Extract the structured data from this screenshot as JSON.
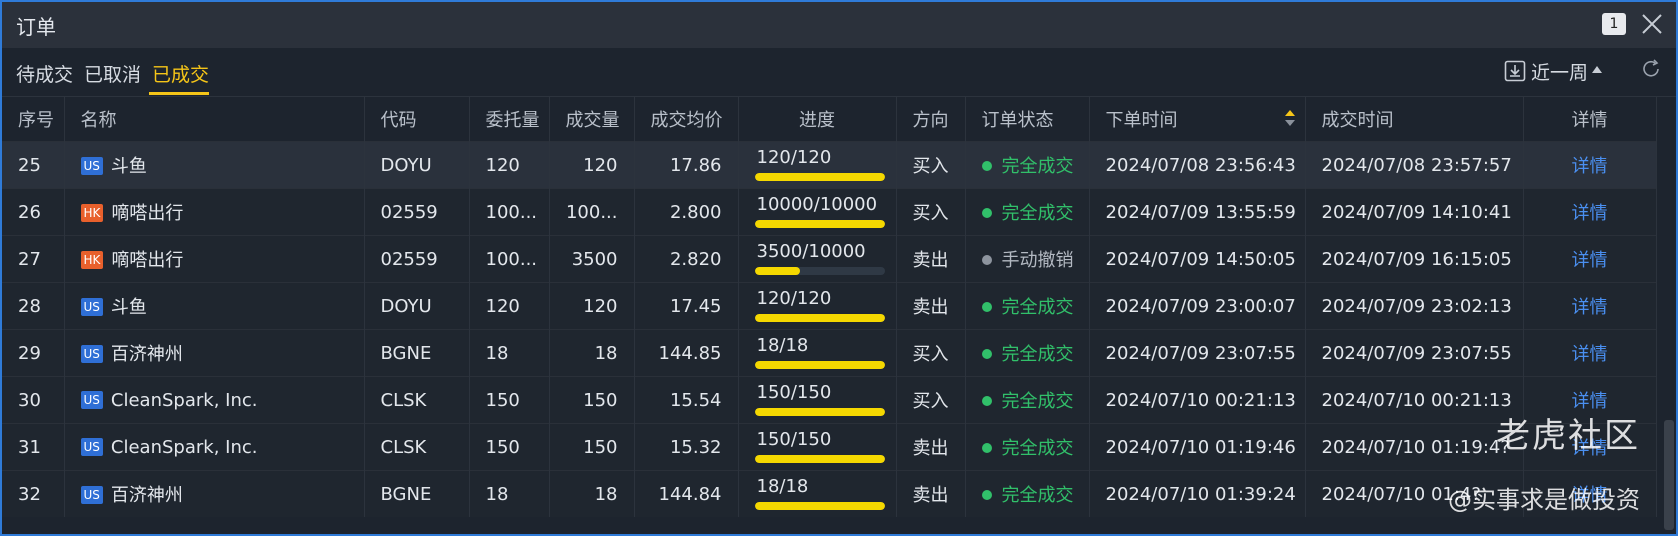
{
  "window": {
    "title": "订单",
    "badge": "1"
  },
  "tabs": [
    {
      "label": "待成交"
    },
    {
      "label": "已取消"
    },
    {
      "label": "已成交"
    }
  ],
  "filter": {
    "period": "近一周"
  },
  "columns": {
    "seq": "序号",
    "name": "名称",
    "code": "代码",
    "order_qty": "委托量",
    "filled_qty": "成交量",
    "avg_price": "成交均价",
    "progress": "进度",
    "direction": "方向",
    "status": "订单状态",
    "order_time": "下单时间",
    "fill_time": "成交时间",
    "detail": "详情"
  },
  "rows": [
    {
      "seq": "25",
      "market": "US",
      "name": "斗鱼",
      "code": "DOYU",
      "order_qty": "120",
      "filled_qty": "120",
      "avg_price": "17.86",
      "progress_text": "120/120",
      "progress": 1.0,
      "direction": "买入",
      "dir_type": "buy",
      "status": "完全成交",
      "status_type": "filled",
      "order_time": "2024/07/08 23:56:43",
      "fill_time": "2024/07/08 23:57:57",
      "detail": "详情"
    },
    {
      "seq": "26",
      "market": "HK",
      "name": "嘀嗒出行",
      "code": "02559",
      "order_qty": "100...",
      "filled_qty": "100...",
      "avg_price": "2.800",
      "progress_text": "10000/10000",
      "progress": 1.0,
      "direction": "买入",
      "dir_type": "buy",
      "status": "完全成交",
      "status_type": "filled",
      "order_time": "2024/07/09 13:55:59",
      "fill_time": "2024/07/09 14:10:41",
      "detail": "详情"
    },
    {
      "seq": "27",
      "market": "HK",
      "name": "嘀嗒出行",
      "code": "02559",
      "order_qty": "100...",
      "filled_qty": "3500",
      "avg_price": "2.820",
      "progress_text": "3500/10000",
      "progress": 0.35,
      "direction": "卖出",
      "dir_type": "sell",
      "status": "手动撤销",
      "status_type": "cancelled",
      "order_time": "2024/07/09 14:50:05",
      "fill_time": "2024/07/09 16:15:05",
      "detail": "详情"
    },
    {
      "seq": "28",
      "market": "US",
      "name": "斗鱼",
      "code": "DOYU",
      "order_qty": "120",
      "filled_qty": "120",
      "avg_price": "17.45",
      "progress_text": "120/120",
      "progress": 1.0,
      "direction": "卖出",
      "dir_type": "sell",
      "status": "完全成交",
      "status_type": "filled",
      "order_time": "2024/07/09 23:00:07",
      "fill_time": "2024/07/09 23:02:13",
      "detail": "详情"
    },
    {
      "seq": "29",
      "market": "US",
      "name": "百济神州",
      "code": "BGNE",
      "order_qty": "18",
      "filled_qty": "18",
      "avg_price": "144.85",
      "progress_text": "18/18",
      "progress": 1.0,
      "direction": "买入",
      "dir_type": "buy",
      "status": "完全成交",
      "status_type": "filled",
      "order_time": "2024/07/09 23:07:55",
      "fill_time": "2024/07/09 23:07:55",
      "detail": "详情"
    },
    {
      "seq": "30",
      "market": "US",
      "name": "CleanSpark, Inc.",
      "code": "CLSK",
      "order_qty": "150",
      "filled_qty": "150",
      "avg_price": "15.54",
      "progress_text": "150/150",
      "progress": 1.0,
      "direction": "买入",
      "dir_type": "buy",
      "status": "完全成交",
      "status_type": "filled",
      "order_time": "2024/07/10 00:21:13",
      "fill_time": "2024/07/10 00:21:13",
      "detail": "详情"
    },
    {
      "seq": "31",
      "market": "US",
      "name": "CleanSpark, Inc.",
      "code": "CLSK",
      "order_qty": "150",
      "filled_qty": "150",
      "avg_price": "15.32",
      "progress_text": "150/150",
      "progress": 1.0,
      "direction": "卖出",
      "dir_type": "sell",
      "status": "完全成交",
      "status_type": "filled",
      "order_time": "2024/07/10 01:19:46",
      "fill_time": "2024/07/10 01:19:4?",
      "detail": "详情"
    },
    {
      "seq": "32",
      "market": "US",
      "name": "百济神州",
      "code": "BGNE",
      "order_qty": "18",
      "filled_qty": "18",
      "avg_price": "144.84",
      "progress_text": "18/18",
      "progress": 1.0,
      "direction": "卖出",
      "dir_type": "sell",
      "status": "完全成交",
      "status_type": "filled",
      "order_time": "2024/07/10 01:39:24",
      "fill_time": "2024/07/10 01:4?",
      "detail": "详情"
    }
  ],
  "watermark": {
    "brand": "老虎社区",
    "handle": "@实事求是做投资"
  },
  "colors": {
    "accent": "#f5c518",
    "buy": "#e84a4a",
    "sell": "#31c06a",
    "link": "#4a8ff0",
    "progress": "#f5d800",
    "us_tag": "#2f6fd6",
    "hk_tag": "#e8602c"
  },
  "icons": {
    "close": "close-icon",
    "download": "download-icon",
    "refresh": "refresh-icon",
    "sort": "sort-icon",
    "caret": "caret-up-icon"
  }
}
